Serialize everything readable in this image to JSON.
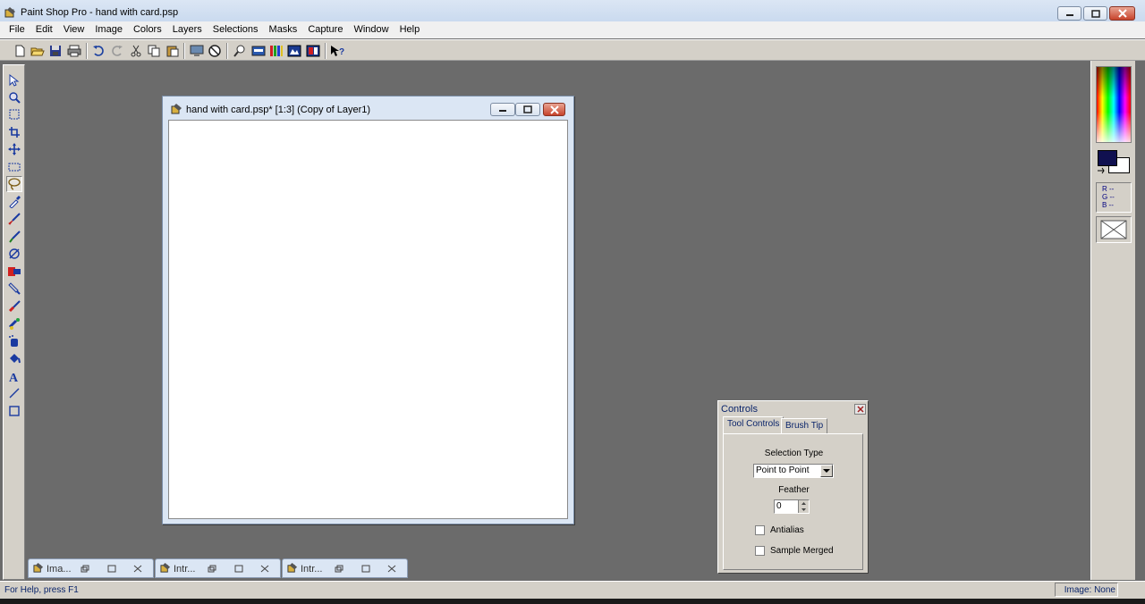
{
  "app": {
    "title": "Paint Shop Pro - hand with card.psp",
    "icon": "psp-app-icon"
  },
  "menu": [
    "File",
    "Edit",
    "View",
    "Image",
    "Colors",
    "Layers",
    "Selections",
    "Masks",
    "Capture",
    "Window",
    "Help"
  ],
  "toolbar": {
    "buttons": [
      "new-icon",
      "open-icon",
      "save-icon",
      "print-icon",
      "undo-icon",
      "redo-icon",
      "cut-icon",
      "copy-icon",
      "paste-icon",
      "monitor-icon",
      "stop-icon",
      "zoom-icon",
      "overview-icon",
      "histogram-icon",
      "layer-icon",
      "color-palette-icon",
      "help-icon"
    ]
  },
  "tools": [
    "arrow-tool-icon",
    "zoom-tool-icon",
    "deform-tool-icon",
    "crop-tool-icon",
    "mover-tool-icon",
    "selection-tool-icon",
    "freehand-tool-icon",
    "dropper-tool-icon",
    "paintbrush-tool-icon",
    "clone-brush-tool-icon",
    "color-replacer-tool-icon",
    "retouch-tool-icon",
    "scratch-remover-tool-icon",
    "eraser-tool-icon",
    "picture-tube-tool-icon",
    "airbrush-tool-icon",
    "flood-fill-tool-icon",
    "text-tool-icon",
    "draw-tool-icon",
    "shape-tool-icon"
  ],
  "colors": {
    "foreground": "#101050",
    "background": "#ffffff",
    "accent": "#0a246a"
  },
  "rgb_readout": {
    "r": "R --",
    "g": "G --",
    "b": "B --"
  },
  "image_window": {
    "title": "hand with card.psp* [1:3] (Copy of Layer1)"
  },
  "minimized_windows": [
    {
      "label": "Ima..."
    },
    {
      "label": "Intr..."
    },
    {
      "label": "Intr..."
    }
  ],
  "controls": {
    "title": "Controls",
    "tabs": [
      "Tool Controls",
      "Brush Tip"
    ],
    "selection_type_label": "Selection Type",
    "selection_type_value": "Point to Point",
    "feather_label": "Feather",
    "feather_value": "0",
    "antialias_label": "Antialias",
    "antialias_checked": false,
    "sample_merged_label": "Sample Merged",
    "sample_merged_checked": false
  },
  "status": {
    "help": "For Help, press F1",
    "image": "Image: None"
  }
}
